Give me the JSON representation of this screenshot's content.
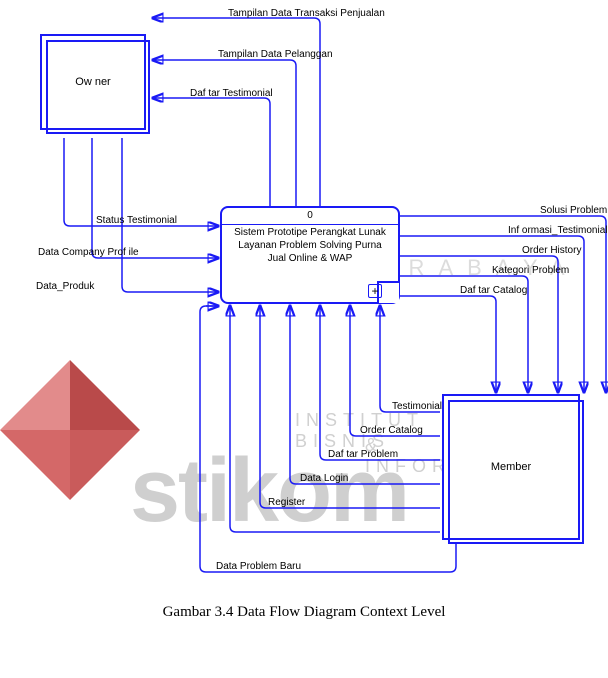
{
  "caption": "Gambar 3.4 Data Flow Diagram Context Level",
  "entities": {
    "owner": {
      "label": "Ow ner"
    },
    "member": {
      "label": "Member"
    }
  },
  "process": {
    "id": "0",
    "line1": "Sistem Prototipe Perangkat Lunak",
    "line2": "Layanan Problem Solving Purna",
    "line3": "Jual Online & WAP",
    "expand": "+"
  },
  "flows": {
    "f1": "Tampilan Data Transaksi Penjualan",
    "f2": "Tampilan Data Pelanggan",
    "f3": "Daf tar Testimonial",
    "f4": "Status Testimonial",
    "f5": "Data Company  Prof ile",
    "f6": "Data_Produk",
    "f7": "Solusi Problem",
    "f8": "Inf ormasi_Testimonial",
    "f9": "Order History",
    "f10": "Kategori Problem",
    "f11": "Daf tar Catalog",
    "f12": "Testimonial",
    "f13": "Order Catalog",
    "f14": "Daf tar Problem",
    "f15": "Data Login",
    "f16": "Register",
    "f17": "Data Problem Baru"
  },
  "watermark": {
    "brand": "stikom",
    "tag1": "INSTITUT BISNIS",
    "tag2": "& INFORMATIKA",
    "city": "SURABAYA"
  }
}
